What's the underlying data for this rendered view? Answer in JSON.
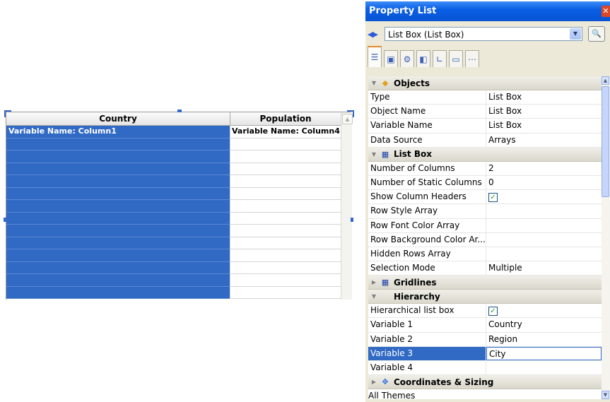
{
  "listbox": {
    "headers": [
      "Country",
      "Population"
    ],
    "rows": [
      [
        "Variable Name: Column1",
        "Variable Name: Column4"
      ],
      [
        "",
        ""
      ],
      [
        "",
        ""
      ],
      [
        "",
        ""
      ],
      [
        "",
        ""
      ],
      [
        "",
        ""
      ],
      [
        "",
        ""
      ],
      [
        "",
        ""
      ],
      [
        "",
        ""
      ],
      [
        "",
        ""
      ],
      [
        "",
        ""
      ],
      [
        "",
        ""
      ],
      [
        "",
        ""
      ],
      [
        "",
        ""
      ]
    ]
  },
  "property_list": {
    "title": "Property List",
    "selector_value": "List Box (List Box)",
    "tabs": [
      "list-tab",
      "form-tab",
      "gear-tab",
      "objects-tab",
      "graph-tab",
      "monitor-tab",
      "more-tab"
    ],
    "footer": "All Themes",
    "colors": {
      "title_bar": "#0a5fe4",
      "selection": "#316ac5"
    },
    "sections": [
      {
        "title": "Objects",
        "icon": "box-icon",
        "expanded": true,
        "rows": [
          {
            "key": "Type",
            "value": "List Box"
          },
          {
            "key": "Object Name",
            "value": "List Box"
          },
          {
            "key": "Variable Name",
            "value": "List Box"
          },
          {
            "key": "Data Source",
            "value": "Arrays"
          }
        ]
      },
      {
        "title": "List Box",
        "icon": "grid-icon",
        "expanded": true,
        "rows": [
          {
            "key": "Number of Columns",
            "value": "2"
          },
          {
            "key": "Number of Static Columns",
            "value": "0"
          },
          {
            "key": "Show Column Headers",
            "value": "",
            "checkbox": true
          },
          {
            "key": "Row Style Array",
            "value": ""
          },
          {
            "key": "Row Font Color Array",
            "value": ""
          },
          {
            "key": "Row Background Color Ar...",
            "value": ""
          },
          {
            "key": "Hidden Rows Array",
            "value": ""
          },
          {
            "key": "Selection Mode",
            "value": "Multiple"
          }
        ]
      },
      {
        "title": "Gridlines",
        "icon": "grid-icon",
        "expanded": false,
        "rows": []
      },
      {
        "title": "Hierarchy",
        "icon": "",
        "expanded": true,
        "rows": [
          {
            "key": "Hierarchical list box",
            "value": "",
            "checkbox": true
          },
          {
            "key": "Variable 1",
            "value": "Country"
          },
          {
            "key": "Variable 2",
            "value": "Region"
          },
          {
            "key": "Variable 3",
            "value": "City",
            "selected": true
          },
          {
            "key": "Variable 4",
            "value": ""
          }
        ]
      },
      {
        "title": "Coordinates & Sizing",
        "icon": "move-icon",
        "expanded": false,
        "rows": []
      }
    ]
  }
}
